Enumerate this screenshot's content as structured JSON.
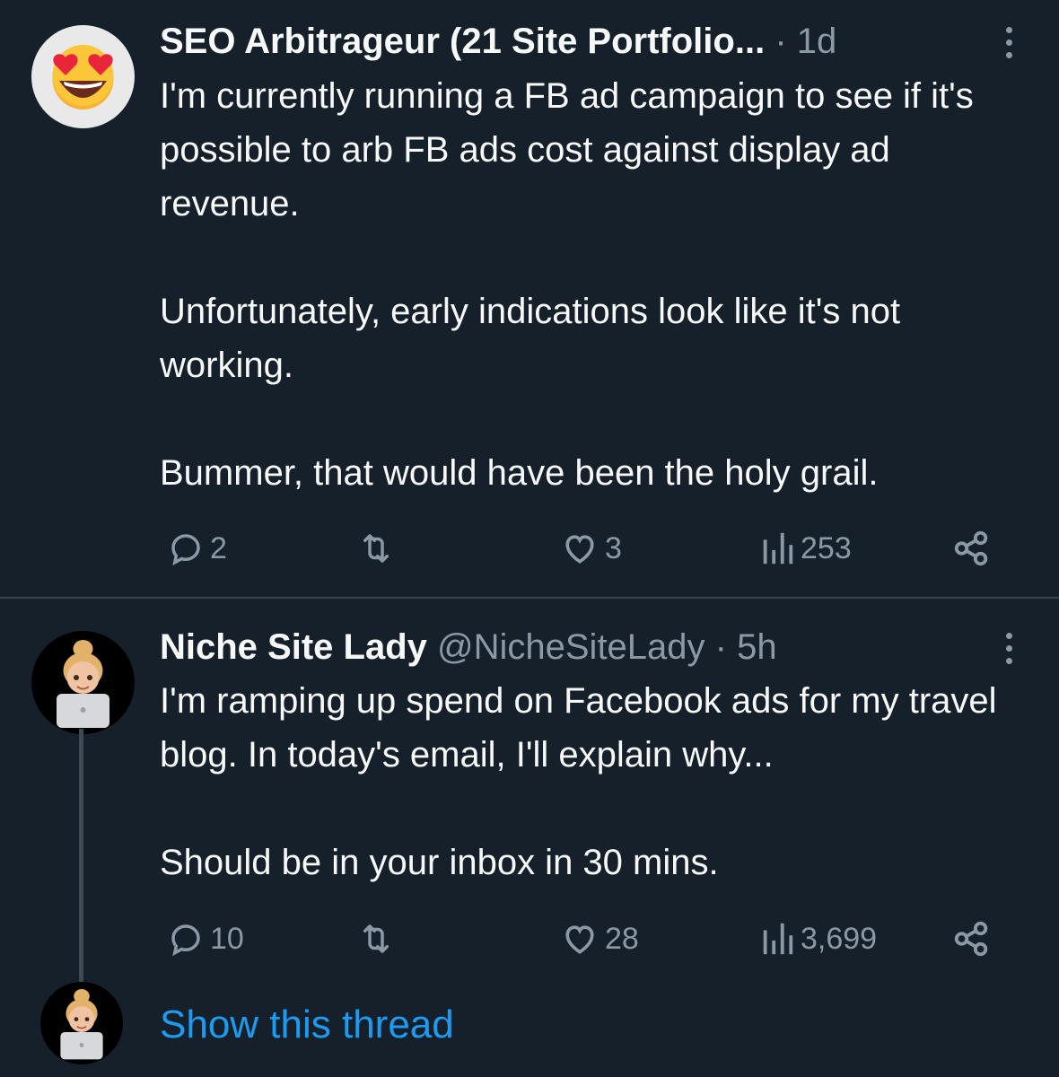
{
  "tweets": [
    {
      "display_name": "SEO Arbitrageur (21 Site Portfolio...",
      "handle": "",
      "separator": "·",
      "time": "1d",
      "avatar_icon": "heart-eyes-emoji-icon",
      "paragraphs": [
        "I'm currently running a FB ad campaign to see if it's possible to arb FB ads cost against display ad revenue.",
        "Unfortunately, early indications look like it's not working.",
        "Bummer, that would have been the holy grail."
      ],
      "replies": "2",
      "retweets": "",
      "likes": "3",
      "views": "253"
    },
    {
      "display_name": "Niche Site Lady",
      "handle": "@NicheSiteLady",
      "separator": "·",
      "time": "5h",
      "avatar_icon": "memoji-avatar-icon",
      "paragraphs": [
        "I'm ramping up spend on Facebook ads for my travel blog. In today's email, I'll explain why...",
        "Should be in your inbox in 30 mins."
      ],
      "replies": "10",
      "retweets": "",
      "likes": "28",
      "views": "3,699"
    }
  ],
  "show_thread_label": "Show this thread",
  "colors": {
    "background": "#15202b",
    "text": "#f7f9f9",
    "muted": "#8b98a5",
    "link": "#1d9bf0",
    "divider": "#38444d"
  }
}
